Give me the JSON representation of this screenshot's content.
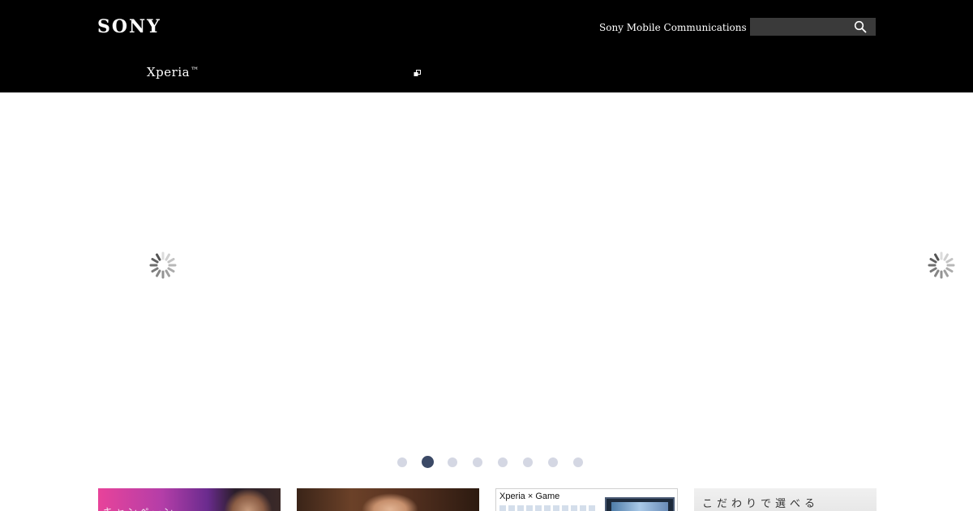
{
  "header": {
    "logo": "SONY",
    "company_link": "Sony Mobile Communications",
    "search": {
      "value": "",
      "placeholder": ""
    },
    "product_title": "Xperia",
    "product_title_mark": "™"
  },
  "carousel": {
    "dot_count": 8,
    "active_index": 1
  },
  "tiles": [
    {
      "caption": "キャンペーン"
    },
    {
      "caption": ""
    },
    {
      "label": "Xperia × Game"
    },
    {
      "label": "こだわりで選べる"
    }
  ],
  "icons": {
    "search": "search-icon",
    "external": "external-link-icon",
    "loading": "loading-spinner-icon"
  },
  "colors": {
    "header_bg": "#000000",
    "dot_inactive": "#d4d7e3",
    "dot_active": "#3b4966"
  }
}
